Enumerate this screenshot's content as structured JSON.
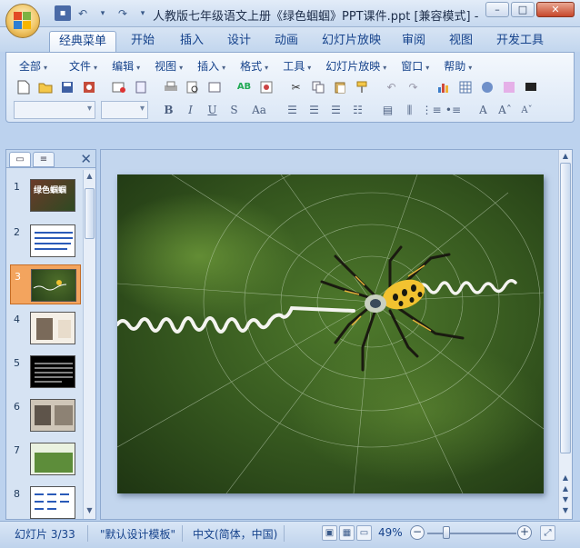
{
  "window": {
    "title": "人教版七年级语文上册《绿色蝈蝈》PPT课件.ppt [兼容模式] - M...",
    "minimize": "–",
    "maximize": "□",
    "close": "✕"
  },
  "office_button": {
    "icon": "office-logo"
  },
  "qat": {
    "save": "💾",
    "undo": "↶",
    "redo": "↷",
    "customize": "▾"
  },
  "tabs": [
    "经典菜单",
    "开始",
    "插入",
    "设计",
    "动画",
    "幻灯片放映",
    "审阅",
    "视图",
    "开发工具"
  ],
  "active_tab": "经典菜单",
  "menus": [
    "全部",
    "文件",
    "编辑",
    "视图",
    "插入",
    "格式",
    "工具",
    "幻灯片放映",
    "窗口",
    "帮助"
  ],
  "font": {
    "bold": "B",
    "italic": "I",
    "underline": "U",
    "strike": "S",
    "case": "Aa"
  },
  "left_panel": {
    "tab_slides": "▭",
    "tab_outline": "≡",
    "close": "✕",
    "slides": [
      {
        "num": "1",
        "thumb_title": "绿色蝈蝈"
      },
      {
        "num": "2",
        "thumb_title": ""
      },
      {
        "num": "3",
        "thumb_title": ""
      },
      {
        "num": "4",
        "thumb_title": ""
      },
      {
        "num": "5",
        "thumb_title": ""
      },
      {
        "num": "6",
        "thumb_title": ""
      },
      {
        "num": "7",
        "thumb_title": ""
      },
      {
        "num": "8",
        "thumb_title": ""
      }
    ],
    "selected_slide": "3"
  },
  "status": {
    "slide_info": "幻灯片 3/33",
    "template": "\"默认设计模板\"",
    "language": "中文(简体，中国)",
    "zoom": "49%",
    "zoom_out": "−",
    "zoom_in": "+"
  },
  "colors": {
    "accent": "#f3a45e",
    "ribbon": "#dbe7f6",
    "text": "#15428b"
  }
}
